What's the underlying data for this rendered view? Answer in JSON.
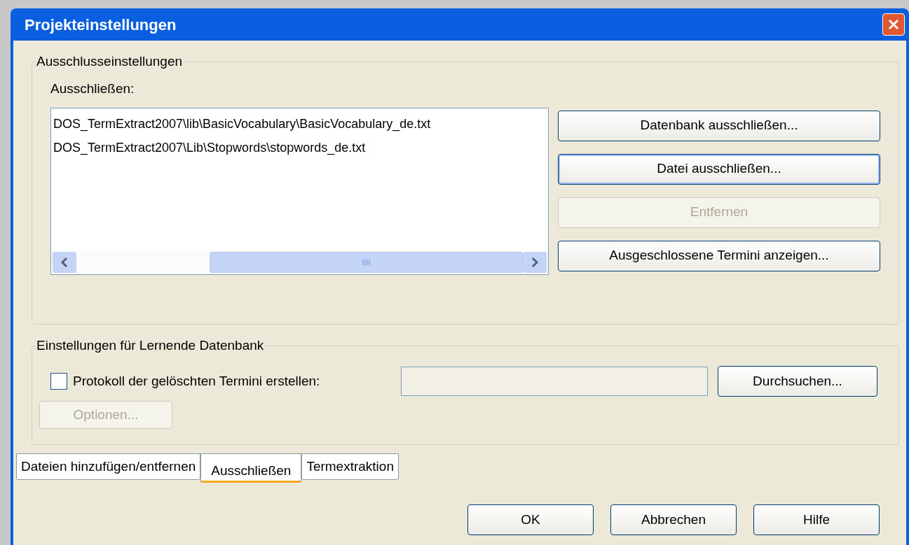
{
  "window": {
    "title": "Projekteinstellungen"
  },
  "exclusion_group": {
    "legend": "Ausschlusseinstellungen",
    "list_label": "Ausschließen:",
    "files": [
      "DOS_TermExtract2007\\lib\\BasicVocabulary\\BasicVocabulary_de.txt",
      "DOS_TermExtract2007\\Lib\\Stopwords\\stopwords_de.txt"
    ],
    "buttons": [
      {
        "label": "Datenbank ausschließen...",
        "disabled": false,
        "focused": false
      },
      {
        "label": "Datei ausschließen...",
        "disabled": false,
        "focused": true
      },
      {
        "label": "Entfernen",
        "disabled": true,
        "focused": false
      },
      {
        "label": "Ausgeschlossene Termini anzeigen...",
        "disabled": false,
        "focused": false
      }
    ]
  },
  "learning_group": {
    "legend": "Einstellungen für Lernende Datenbank",
    "log_checkbox": {
      "label": "Protokoll der gelöschten Termini erstellen:",
      "checked": false
    },
    "path_field": {
      "disabled": true
    },
    "browse_button": {
      "label": "Durchsuchen...",
      "disabled": false
    },
    "options_button": {
      "label": "Optionen...",
      "disabled": true
    }
  },
  "tabs": [
    {
      "label": "Dateien hinzufügen/entfernen",
      "selected": false
    },
    {
      "label": "Ausschließen",
      "selected": true
    },
    {
      "label": "Termextraktion",
      "selected": false
    }
  ],
  "buttons": [
    "OK",
    "Abbrechen",
    "Hilfe"
  ]
}
